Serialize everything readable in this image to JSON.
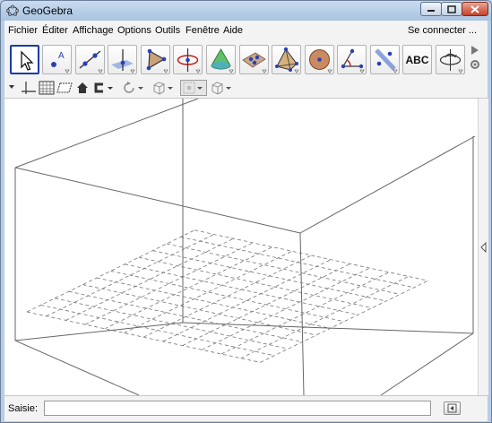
{
  "window": {
    "title": "GeoGebra",
    "icons": [
      "geogebra-logo-icon",
      "minimize-icon",
      "maximize-icon",
      "close-icon"
    ]
  },
  "menu": {
    "items": [
      "Fichier",
      "Éditer",
      "Affichage",
      "Options",
      "Outils",
      "Fenêtre",
      "Aide"
    ],
    "connect": "Se connecter ..."
  },
  "toolbar": {
    "tools": [
      "move",
      "point",
      "line",
      "perpendicular",
      "polygon",
      "circle-axis",
      "cone",
      "plane-through-points",
      "pyramid",
      "sphere",
      "angle",
      "reflect",
      "text",
      "rotate-view"
    ],
    "text_tool_label": "ABC",
    "selected_tool": "move"
  },
  "stylebar": {
    "items": [
      "stylebar-toggle-icon",
      "axes-icon",
      "grid-icon",
      "plane-icon",
      "home-icon",
      "clipping-icon",
      "rotate-view-icon",
      "view-direction-icon",
      "point-capture-icon",
      "projection-icon"
    ]
  },
  "input": {
    "label": "Saisie:",
    "value": ""
  },
  "colors": {
    "selected_border": "#1a3aa8",
    "point_blue": "#2b3fb5",
    "plane_blue": "#6f8fd6"
  }
}
